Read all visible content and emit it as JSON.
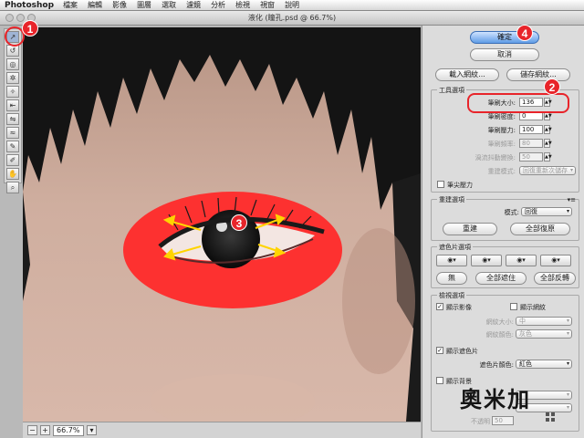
{
  "menubar": {
    "app": "Photoshop",
    "items": [
      "檔案",
      "編輯",
      "影像",
      "圖層",
      "選取",
      "濾鏡",
      "分析",
      "檢視",
      "視窗",
      "說明"
    ]
  },
  "window": {
    "title": "液化 (瞳孔.psd @ 66.7%)"
  },
  "status": {
    "zoom": "66.7%"
  },
  "buttons": {
    "ok": "確定",
    "cancel": "取消",
    "load_mesh": "載入網紋...",
    "save_mesh": "儲存網紋..."
  },
  "tool_options": {
    "title": "工具選項",
    "brush_size_label": "筆刷大小:",
    "brush_size_value": "136",
    "brush_density_label": "筆刷密度:",
    "brush_density_value": "0",
    "brush_pressure_label": "筆刷壓力:",
    "brush_pressure_value": "100",
    "brush_rate_label": "筆刷頻率:",
    "brush_rate_value": "80",
    "turbulent_jitter_label": "渦流抖動變換:",
    "turbulent_jitter_value": "50",
    "reconstruct_mode_label": "重建模式:",
    "reconstruct_mode_value": "回復重新次儲存",
    "stylus_pressure_label": "筆尖壓力"
  },
  "reconstruct": {
    "title": "重建選項",
    "mode_label": "模式:",
    "mode_value": "回復",
    "reconstruct_button": "重建",
    "restore_all_button": "全部復原"
  },
  "mask": {
    "title": "遮色片選項",
    "none_button": "無",
    "mask_all_button": "全部遮住",
    "invert_all_button": "全部反轉"
  },
  "view": {
    "title": "檢視選項",
    "show_image_label": "顯示影像",
    "show_mesh_label": "顯示網紋",
    "mesh_size_label": "網紋大小:",
    "mesh_size_value": "中",
    "mesh_color_label": "網紋顏色:",
    "mesh_color_value": "灰色",
    "show_mask_label": "顯示遮色片",
    "mask_color_label": "遮色片顏色:",
    "mask_color_value": "紅色",
    "show_backdrop_label": "顯示背景",
    "opacity_label": "不透明",
    "opacity_value": "50"
  },
  "annotations": [
    "1",
    "2",
    "3",
    "4"
  ],
  "watermark": "奧米加",
  "colors": {
    "mask_red": "#ff2a2a",
    "badge_red": "#e8242a",
    "ok_blue": "#5f9ce6"
  }
}
